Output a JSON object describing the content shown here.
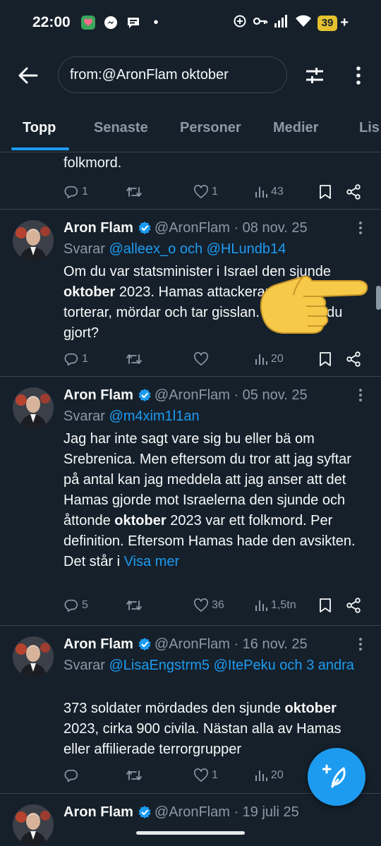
{
  "status_bar": {
    "time": "22:00",
    "battery": "39",
    "battery_extra": "+",
    "notification_dot": "•"
  },
  "search": {
    "value": "from:@AronFlam oktober"
  },
  "tabs": [
    "Topp",
    "Senaste",
    "Personer",
    "Medier",
    "Lis"
  ],
  "previous_tweet": {
    "text_tail": "folkmord.",
    "stats": {
      "replies": "1",
      "reposts": "",
      "likes": "1",
      "views": "43"
    }
  },
  "tweets": [
    {
      "name": "Aron Flam",
      "handle": "@AronFlam · 08 nov. 25",
      "reply_prefix": "Svarar ",
      "mentions": "@alleex_o och @HLundb14",
      "body_1": "Om du var statsminister i Israel den sjunde ",
      "body_bold": "oktober",
      "body_2": " 2023. Hamas attackerar Israel torterar, mördar och tar gisslan. Vad hade du gjort?",
      "stats": {
        "replies": "1",
        "reposts": "",
        "likes": "",
        "views": "20"
      }
    },
    {
      "name": "Aron Flam",
      "handle": "@AronFlam · 05 nov. 25",
      "reply_prefix": "Svarar ",
      "mentions": "@m4xim1l1an",
      "body_1": "Jag har inte sagt vare sig bu eller bä om Srebrenica. Men eftersom du tror att jag syftar på antal kan jag meddela att jag anser att det Hamas gjorde mot Israelerna den sjunde och åttonde ",
      "body_bold": "oktober",
      "body_2": " 2023 var ett folkmord. Per definition. Eftersom Hamas hade den avsikten. Det står i ",
      "more_link": "Visa mer",
      "stats": {
        "replies": "5",
        "reposts": "",
        "likes": "36",
        "views": "1,5tn"
      }
    },
    {
      "name": "Aron Flam",
      "handle": "@AronFlam · 16 nov. 25",
      "reply_prefix": "Svarar ",
      "mentions": "@LisaEngstrm5 @ItePeku och 3 andra",
      "body_1": "373 soldater mördades den sjunde ",
      "body_bold": "oktober",
      "body_2": " 2023, cirka 900 civila. Nästan alla av Hamas eller affilierade terrorgrupper",
      "stats": {
        "replies": "",
        "reposts": "",
        "likes": "1",
        "views": "20"
      }
    },
    {
      "name": "Aron Flam",
      "handle": "@AronFlam · 19 juli 25"
    }
  ],
  "colors": {
    "background": "#15202b",
    "accent": "#1d9bf0",
    "secondary_text": "#8b98a5",
    "divider": "#38444d"
  },
  "icons": [
    "back-arrow-icon",
    "filter-sliders-icon",
    "more-vertical-icon",
    "reply-icon",
    "repost-icon",
    "like-icon",
    "views-icon",
    "bookmark-icon",
    "share-icon",
    "verified-badge-icon",
    "compose-icon",
    "pointing-hand-emoji"
  ]
}
